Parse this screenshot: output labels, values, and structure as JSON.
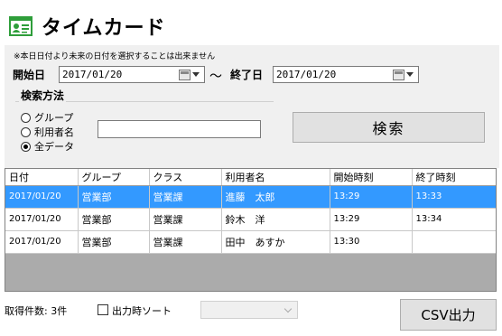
{
  "header": {
    "title": "タイムカード",
    "icon": "timecard-id-icon",
    "icon_color": "#2e9e3a"
  },
  "filter": {
    "note": "※本日日付より未来の日付を選択することは出来ません",
    "start_label": "開始日",
    "start_value": "2017/01/20",
    "tilde": "～",
    "end_label": "終了日",
    "end_value": "2017/01/20"
  },
  "search_method": {
    "legend": "検索方法",
    "options": [
      {
        "label": "グループ",
        "selected": false
      },
      {
        "label": "利用者名",
        "selected": false
      },
      {
        "label": "全データ",
        "selected": true
      }
    ],
    "name_value": ""
  },
  "search_button": "検索",
  "table": {
    "columns": [
      "日付",
      "グループ",
      "クラス",
      "利用者名",
      "開始時刻",
      "終了時刻"
    ],
    "rows": [
      [
        "2017/01/20",
        "営業部",
        "営業課",
        "進藤　太郎",
        "13:29",
        "13:33"
      ],
      [
        "2017/01/20",
        "営業部",
        "営業課",
        "鈴木　洋",
        "13:29",
        "13:34"
      ],
      [
        "2017/01/20",
        "営業部",
        "営業課",
        "田中　あすか",
        "13:30",
        ""
      ]
    ],
    "selected_row": 0,
    "selection_color": "#3399ff"
  },
  "footer": {
    "count_label": "取得件数: 3件",
    "sort_label": "出力時ソート",
    "sort_checked": false,
    "sort_value": "",
    "csv_button": "CSV出力"
  }
}
